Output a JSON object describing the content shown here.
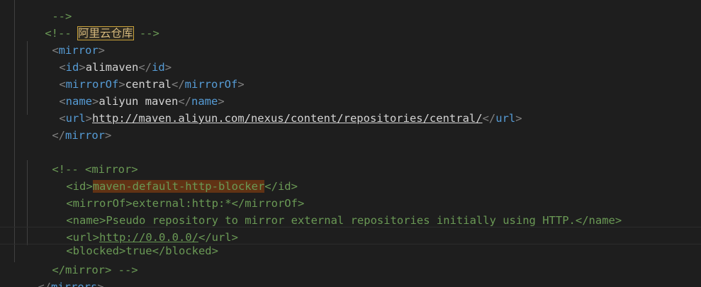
{
  "editor": {
    "lines": {
      "l0_close": "-->",
      "l1_comment_open": "<!-- ",
      "l1_comment_text": "阿里云仓库",
      "l1_comment_close": " -->",
      "l2_open_lt": "<",
      "l2_tag": "mirror",
      "l2_gt": ">",
      "l3_tag": "id",
      "l3_value": "alimaven",
      "l4_tag": "mirrorOf",
      "l4_value": "central",
      "l5_tag": "name",
      "l5_value": "aliyun maven",
      "l6_tag": "url",
      "l6_value": "http://maven.aliyun.com/nexus/content/repositories/central/",
      "l7_tag": "mirror",
      "l9_comment_start": "<!-- <mirror>",
      "l10_pre": "<id>",
      "l10_value": "maven-default-http-blocker",
      "l10_post": "</id>",
      "l11_text": "<mirrorOf>external:http:*</mirrorOf>",
      "l12_text": "<name>Pseudo repository to mirror external repositories initially using HTTP.</name>",
      "l13_pre": "<url>",
      "l13_value": "http://0.0.0.0/",
      "l13_post": "</url>",
      "l14_text": "<blocked>true</blocked>",
      "l15_text": "</mirror> -->",
      "l16_tag": "mirrors"
    }
  },
  "colors": {
    "background": "#1e1e1e",
    "tag": "#569cd6",
    "bracket": "#808080",
    "text": "#d4d4d4",
    "comment": "#6a9955",
    "selection_highlight": "#613214",
    "find_box": "#c8a13a"
  }
}
